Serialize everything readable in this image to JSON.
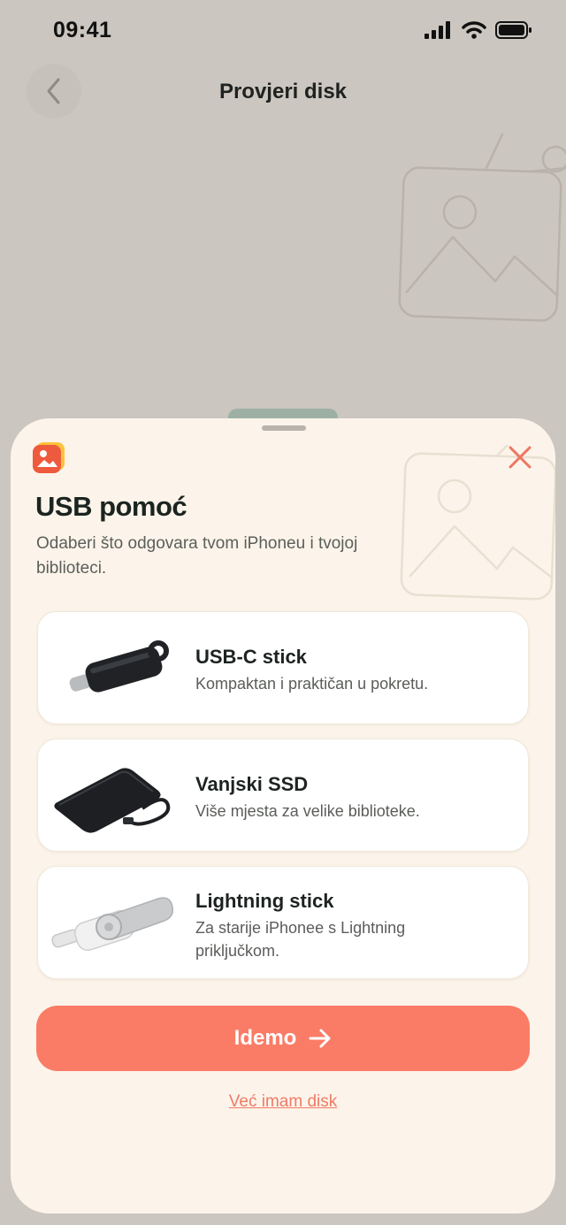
{
  "status_bar": {
    "time": "09:41",
    "signal_icon": "signal-bars-icon",
    "wifi_icon": "wifi-icon",
    "battery_icon": "battery-icon"
  },
  "nav": {
    "title": "Provjeri disk",
    "back_icon": "chevron-left-icon"
  },
  "sheet": {
    "app_icon": "photo-app-icon",
    "close_icon": "close-icon",
    "title": "USB pomoć",
    "subtitle": "Odaberi što odgovara tvom iPhoneu i tvojoj biblioteci.",
    "options": [
      {
        "title": "USB-C stick",
        "description": "Kompaktan i praktičan u pokretu.",
        "image": "usb-c-stick-image"
      },
      {
        "title": "Vanjski SSD",
        "description": "Više mjesta za velike biblioteke.",
        "image": "external-ssd-image"
      },
      {
        "title": "Lightning stick",
        "description": "Za starije iPhonee s Lightning priključkom.",
        "image": "lightning-stick-image"
      }
    ],
    "primary_button": {
      "label": "Idemo",
      "icon": "arrow-right-icon"
    },
    "secondary_link": "Već imam disk"
  },
  "colors": {
    "accent": "#fb7c66",
    "close": "#ee7663",
    "sheet_bg": "#fcf4ea",
    "page_bg": "#cbc6bf"
  }
}
